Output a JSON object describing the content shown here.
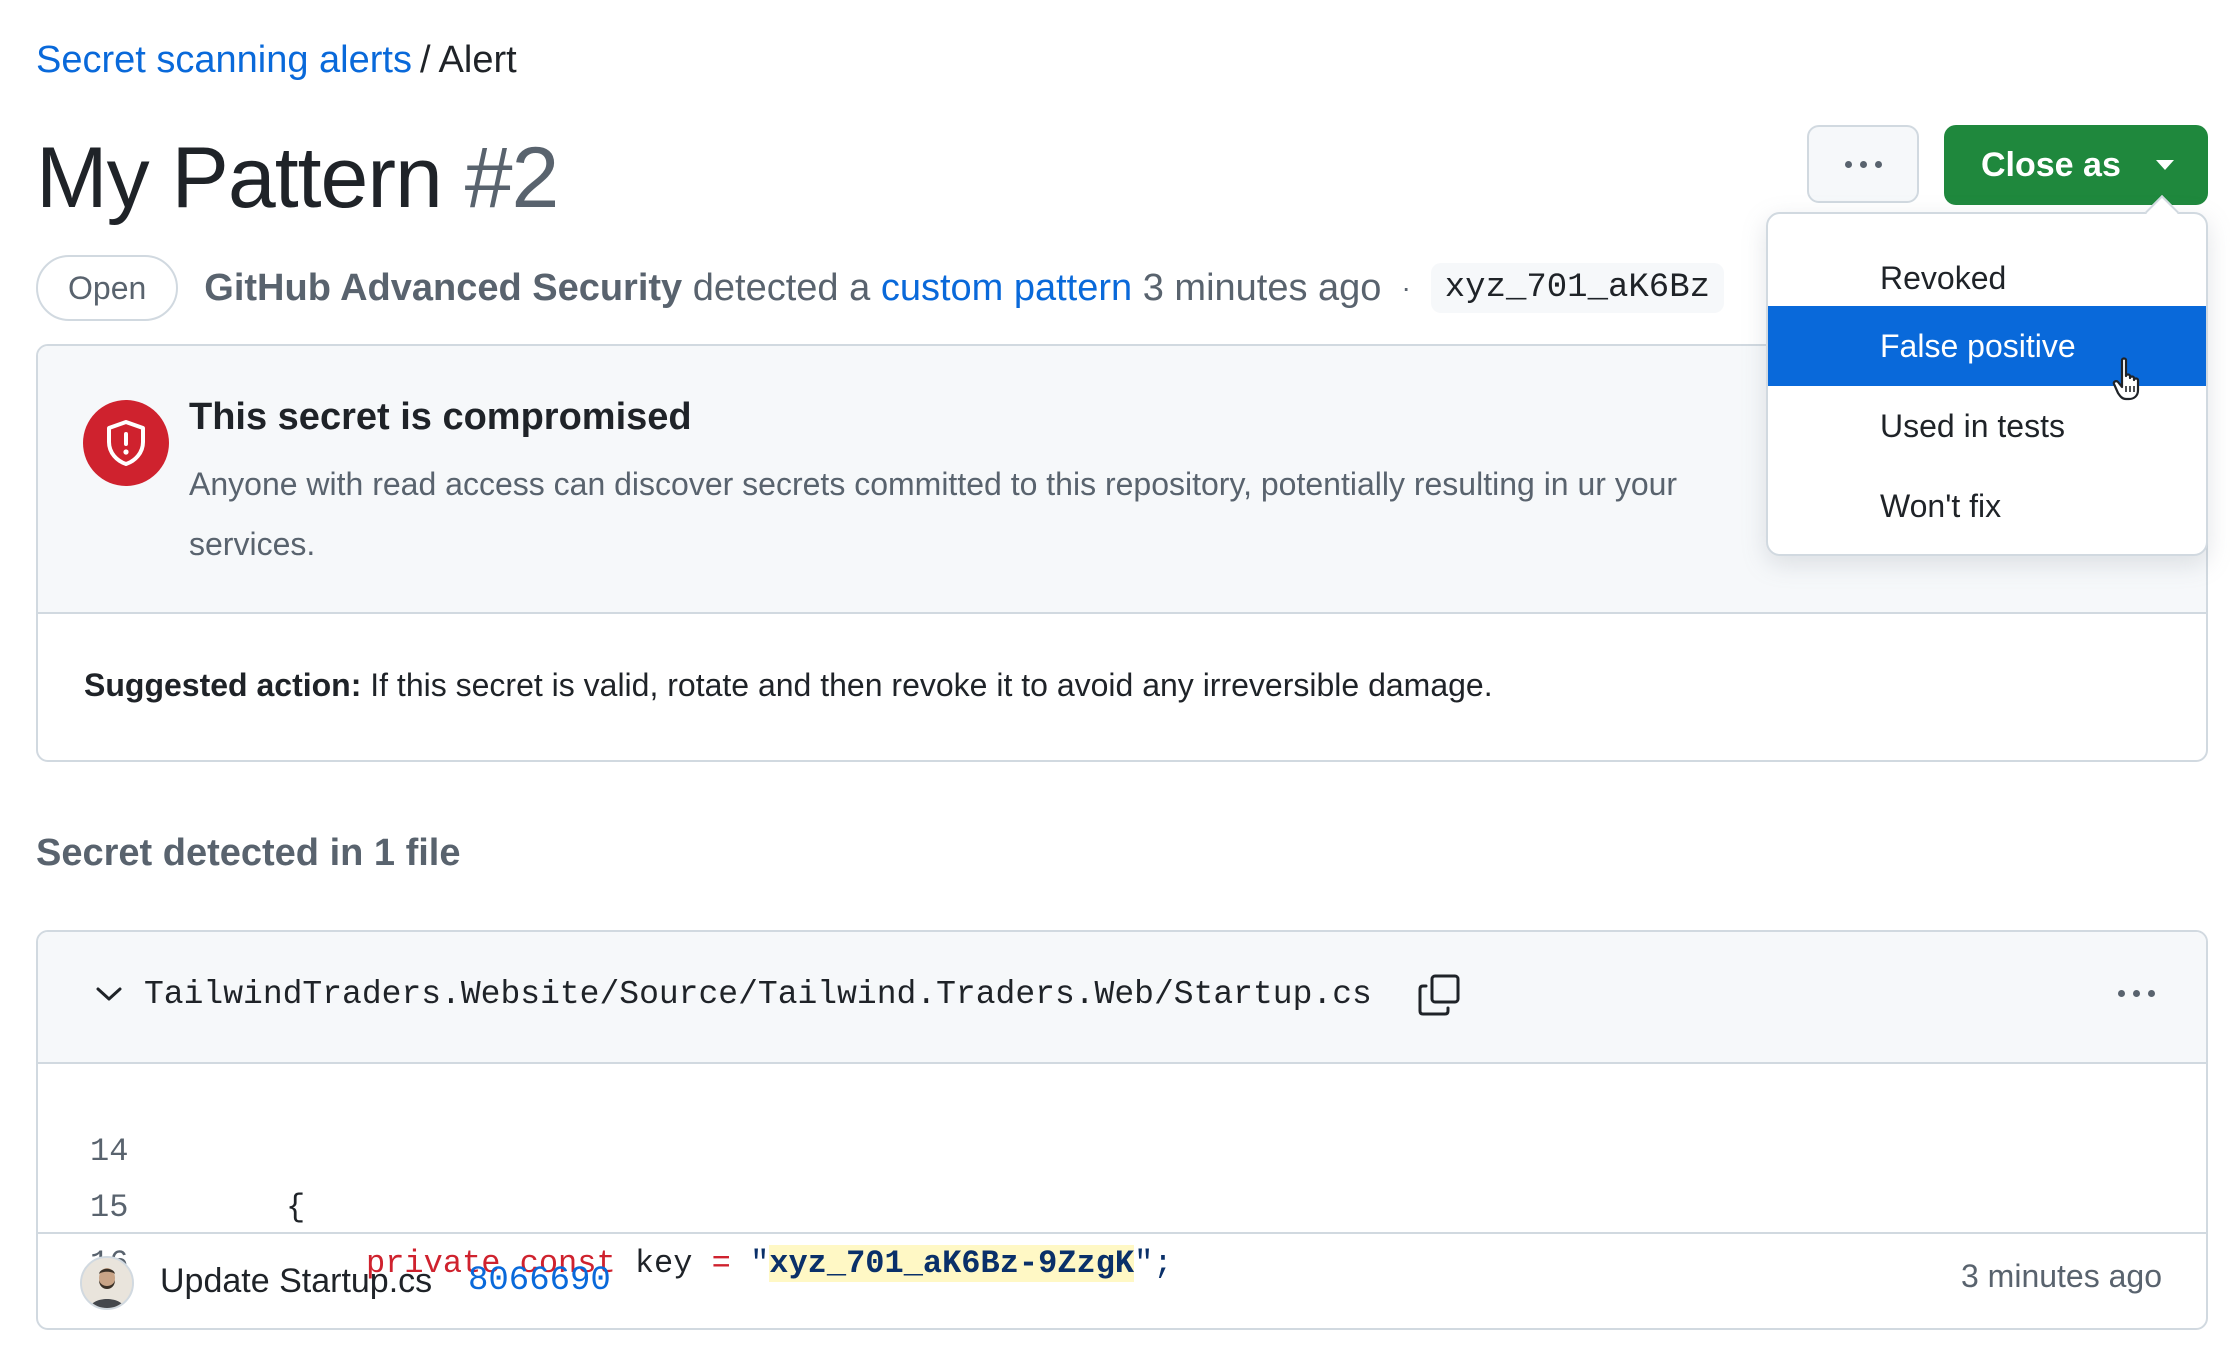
{
  "breadcrumb": {
    "link": "Secret scanning alerts",
    "separator": "/",
    "current": "Alert"
  },
  "header": {
    "title": "My Pattern",
    "number": "#2",
    "more_label": "More options",
    "close_label": "Close as"
  },
  "meta": {
    "state": "Open",
    "actor": "GitHub Advanced Security",
    "text_detected": "detected a",
    "pattern_link": "custom pattern",
    "time": "3 minutes ago",
    "bullet": "·",
    "secret_preview": "xyz_701_aK6Bz"
  },
  "alert": {
    "heading": "This secret is compromised",
    "text": "Anyone with read access can discover secrets committed to this repository, potentially resulting in ur your services.",
    "suggest_label": "Suggested action:",
    "suggest_text": "If this secret is valid, rotate and then revoke it to avoid any irreversible damage."
  },
  "dropdown": {
    "items": [
      "Revoked",
      "False positive",
      "Used in tests",
      "Won't fix"
    ],
    "active_index": 1
  },
  "files": {
    "heading": "Secret detected in 1 file",
    "path": "TailwindTraders.Website/Source/Tailwind.Traders.Web/Startup.cs",
    "lines": [
      {
        "number": "14",
        "text": "{"
      },
      {
        "number": "15",
        "kw1": "private",
        "kw2": "const",
        "ident": "key",
        "op": "=",
        "quote_open": "\"",
        "secret": "xyz_701_aK6Bz-9ZzgK",
        "tail": "\";"
      },
      {
        "number": "16",
        "text": ""
      }
    ],
    "commit": {
      "message": "Update Startup.cs",
      "sha": "8066690",
      "time": "3 minutes ago"
    }
  },
  "colors": {
    "accent": "#0969da",
    "success": "#1f883d",
    "danger": "#cf222e",
    "highlight": "#fff8c5"
  }
}
